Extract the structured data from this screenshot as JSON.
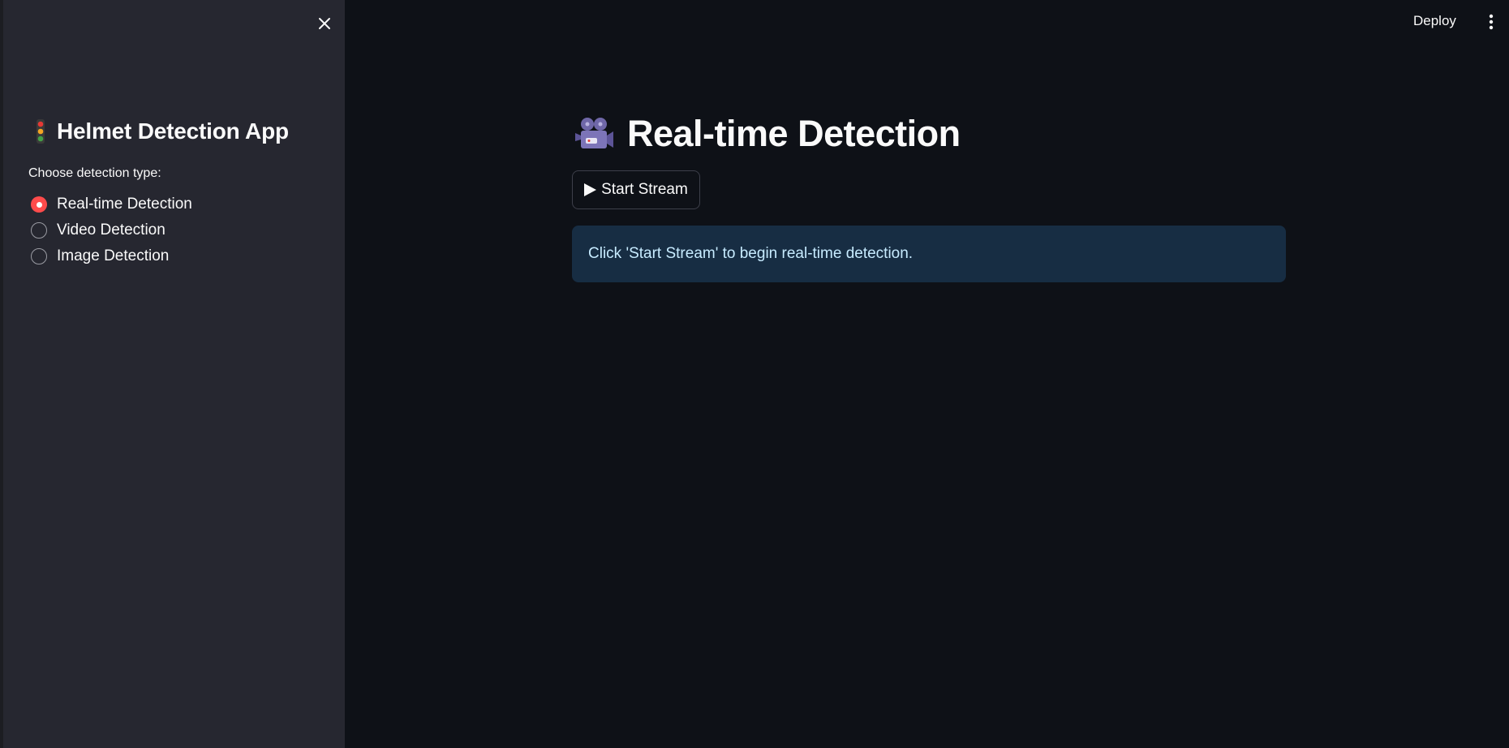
{
  "sidebar": {
    "title": "Helmet Detection App",
    "title_icon": "traffic-light-icon",
    "radio_label": "Choose detection type:",
    "options": [
      {
        "label": "Real-time Detection",
        "checked": true
      },
      {
        "label": "Video Detection",
        "checked": false
      },
      {
        "label": "Image Detection",
        "checked": false
      }
    ]
  },
  "header": {
    "deploy_label": "Deploy",
    "menu_icon": "vertical-ellipsis-icon"
  },
  "main": {
    "title": "Real-time Detection",
    "title_icon": "movie-camera-icon",
    "start_button_label": "Start Stream",
    "info_message": "Click 'Start Stream' to begin real-time detection."
  },
  "colors": {
    "background": "#0e1117",
    "sidebar": "#262730",
    "accent": "#ff4b4b",
    "info_bg": "#172d43",
    "info_text": "#c7ebff"
  }
}
